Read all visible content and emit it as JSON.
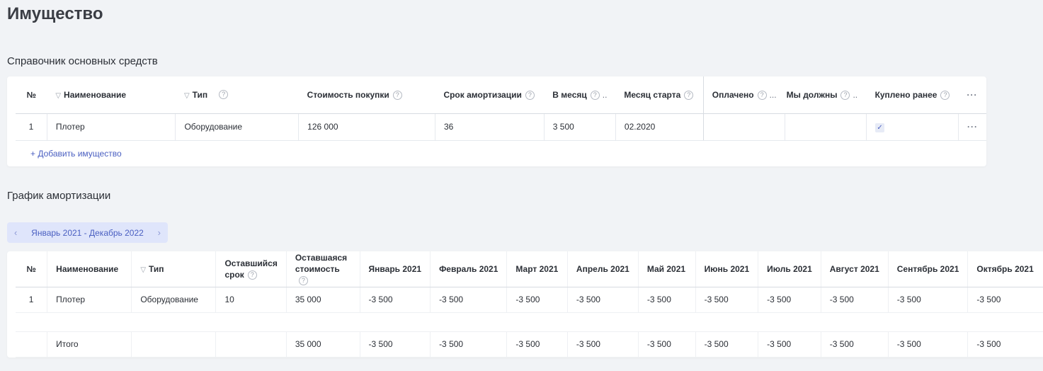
{
  "page": {
    "title": "Имущество"
  },
  "assets": {
    "title": "Справочник основных средств",
    "columns": {
      "num": "№",
      "name": "Наименование",
      "type": "Тип",
      "cost": "Стоимость покупки",
      "term": "Срок амортизации",
      "monthly": "В месяц",
      "start": "Месяц старта",
      "paid": "Оплачено",
      "owe": "Мы должны",
      "bought": "Куплено ранее",
      "more": "···"
    },
    "rows": [
      {
        "num": "1",
        "name": "Плотер",
        "type": "Оборудование",
        "cost": "126 000",
        "term": "36",
        "monthly": "3 500",
        "start": "02.2020",
        "paid": "",
        "owe": "",
        "bought": true,
        "more": "···"
      }
    ],
    "add_label": "+ Добавить имущество"
  },
  "schedule": {
    "title": "График амортизации",
    "period_label": "Январь 2021 - Декабрь 2022",
    "columns": {
      "num": "№",
      "name": "Наименование",
      "type": "Тип",
      "remaining_term": "Оставшийся срок",
      "remaining_cost": "Оставшаяся стоимость",
      "months": [
        "Январь 2021",
        "Февраль 2021",
        "Март 2021",
        "Апрель 2021",
        "Май 2021",
        "Июнь 2021",
        "Июль 2021",
        "Август 2021",
        "Сентябрь 2021",
        "Октябрь 2021"
      ]
    },
    "rows": [
      {
        "num": "1",
        "name": "Плотер",
        "type": "Оборудование",
        "remaining_term": "10",
        "remaining_cost": "35 000",
        "months": [
          "-3 500",
          "-3 500",
          "-3 500",
          "-3 500",
          "-3 500",
          "-3 500",
          "-3 500",
          "-3 500",
          "-3 500",
          "-3 500"
        ]
      }
    ],
    "total": {
      "label": "Итого",
      "remaining_cost": "35 000",
      "months": [
        "-3 500",
        "-3 500",
        "-3 500",
        "-3 500",
        "-3 500",
        "-3 500",
        "-3 500",
        "-3 500",
        "-3 500",
        "-3 500"
      ]
    }
  }
}
